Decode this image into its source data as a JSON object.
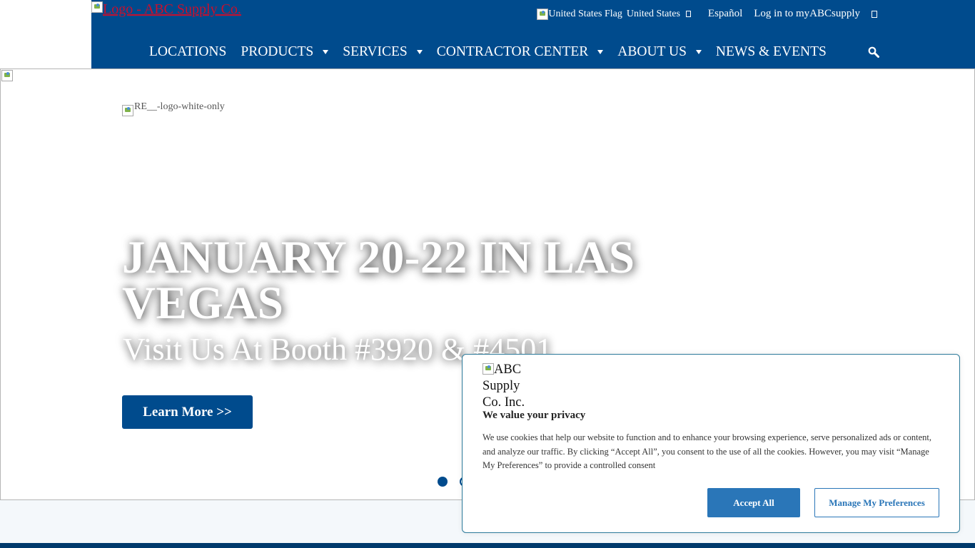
{
  "header": {
    "logo_alt": "Logo - ABC Supply Co.",
    "flag_alt": "United States Flag",
    "country": "United States",
    "espanol": "Español",
    "login": "Log in to myABCsupply"
  },
  "nav": {
    "items": [
      {
        "label": "LOCATIONS"
      },
      {
        "label": "PRODUCTS"
      },
      {
        "label": "SERVICES"
      },
      {
        "label": "CONTRACTOR CENTER"
      },
      {
        "label": "ABOUT US"
      },
      {
        "label": "NEWS & EVENTS"
      }
    ]
  },
  "hero": {
    "event_logo_alt": "RE__-logo-white-only",
    "title": "JANUARY 20-22 IN LAS VEGAS",
    "subtitle": "Visit Us At Booth #3920 & #4501",
    "button": "Learn More >>"
  },
  "cookie": {
    "logo_alt": "ABC Supply Co. Inc.",
    "title": "We value your privacy",
    "text": "We use cookies that help our website to function and to enhance your browsing experience, serve personalized ads or content, and analyze our traffic. By clicking “Accept All”, you consent to the use of all the cookies. However, you may visit “Manage My Preferences” to provide a controlled consent",
    "accept": "Accept All",
    "manage": "Manage My Preferences"
  },
  "colors": {
    "brand_blue": "#004b8d",
    "cookie_button_blue": "#2a76b8",
    "logo_link_red": "#c8102e"
  },
  "icons": {
    "search": "search-icon",
    "broken_image": "broken-image-icon"
  }
}
